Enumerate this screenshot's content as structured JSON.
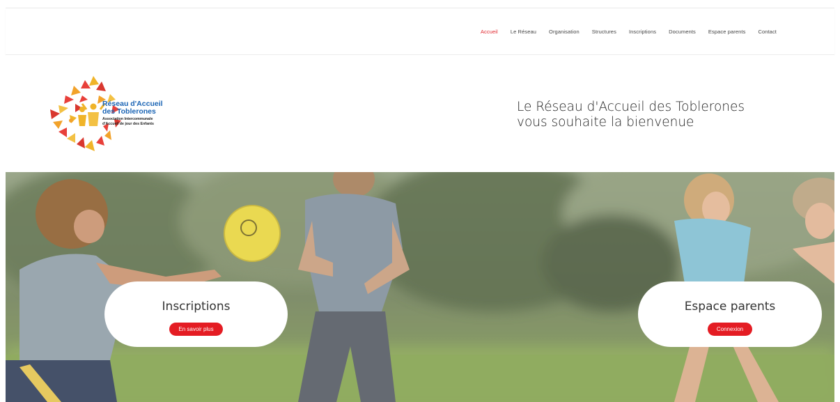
{
  "nav": {
    "items": [
      "Accueil",
      "Le Réseau",
      "Organisation",
      "Structures",
      "Inscriptions",
      "Documents",
      "Espace parents",
      "Contact"
    ],
    "active_color": "#e0262d"
  },
  "logo": {
    "title_line1": "Réseau d'Accueil",
    "title_line2": "des Toblerones",
    "sub_line1": "Association Intercommunale",
    "sub_line2": "d'Accueil de jour des Enfants"
  },
  "welcome": {
    "line1": "Le Réseau d'Accueil des Toblerones",
    "line2": "vous souhaite la bienvenue"
  },
  "cards": {
    "inscriptions": {
      "title": "Inscriptions",
      "button": "En savoir plus"
    },
    "parents": {
      "title": "Espace parents",
      "button": "Connexion"
    }
  },
  "colors": {
    "accent": "#e41c23",
    "brand_blue": "#1a64b4"
  }
}
